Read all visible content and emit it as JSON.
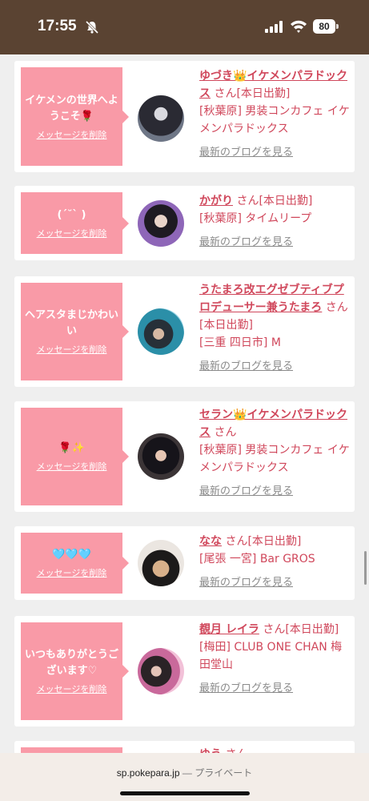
{
  "status": {
    "time": "17:55",
    "battery": "80"
  },
  "cards": [
    {
      "message": "イケメンの世界へようこそ🌹",
      "delete": "メッセージを削除",
      "name": "ゆづき👑イケメンパラドックス",
      "suffix": "さん[本日出勤]",
      "place": "[秋葉原] 男装コンカフェ イケメンパラドックス",
      "blog": "最新のブログを見る"
    },
    {
      "message": "(ˊ˘ˋ )",
      "delete": "メッセージを削除",
      "name": "かがり",
      "suffix": "さん[本日出勤]",
      "place": "[秋葉原] タイムリープ",
      "blog": "最新のブログを見る"
    },
    {
      "message": "ヘアスタまじかわいい",
      "delete": "メッセージを削除",
      "name": "うたまろ改エグゼブティブプロデューサー兼うたまろ",
      "suffix": "さん[本日出勤]",
      "place": "[三重 四日市] M",
      "blog": "最新のブログを見る"
    },
    {
      "message": "🌹✨",
      "delete": "メッセージを削除",
      "name": "セラン👑イケメンパラドックス",
      "suffix": "さん",
      "place": "[秋葉原] 男装コンカフェ イケメンパラドックス",
      "blog": "最新のブログを見る"
    },
    {
      "message": "🩵🩵🩵",
      "delete": "メッセージを削除",
      "name": "なな",
      "suffix": "さん[本日出勤]",
      "place": "[尾張 一宮] Bar GROS",
      "blog": "最新のブログを見る"
    },
    {
      "message": "いつもありがとうございます♡",
      "delete": "メッセージを削除",
      "name": "覩月 レイラ",
      "suffix": "さん[本日出勤]",
      "place": "[梅田] CLUB ONE CHAN 梅田堂山",
      "blog": "最新のブログを見る"
    },
    {
      "message": "",
      "delete": "",
      "name": "ゆう",
      "suffix": "さん",
      "place": "",
      "blog": ""
    }
  ],
  "urlbar": {
    "domain": "sp.pokepara.jp",
    "mode": "— プライベート"
  }
}
